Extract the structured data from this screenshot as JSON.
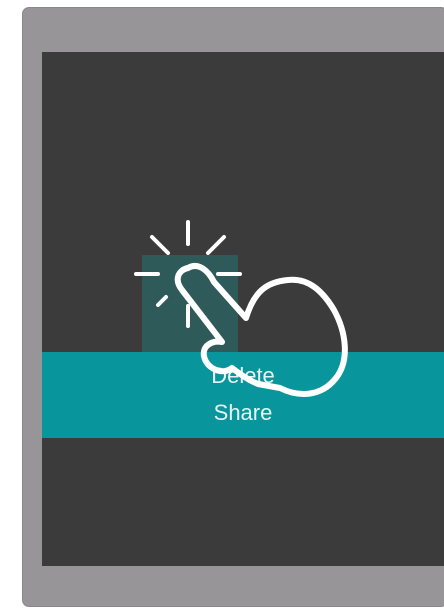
{
  "context_menu": {
    "items": [
      {
        "label": "Delete"
      },
      {
        "label": "Share"
      }
    ]
  },
  "gesture": {
    "icon": "press-and-hold-hand-icon"
  },
  "colors": {
    "device_frame": "#979597",
    "screen_background": "#3b3b3b",
    "menu_background": "#08969c",
    "pressed_tile": "#2f5a5a",
    "menu_text": "#e8f4f4",
    "gesture_stroke": "#ffffff"
  }
}
